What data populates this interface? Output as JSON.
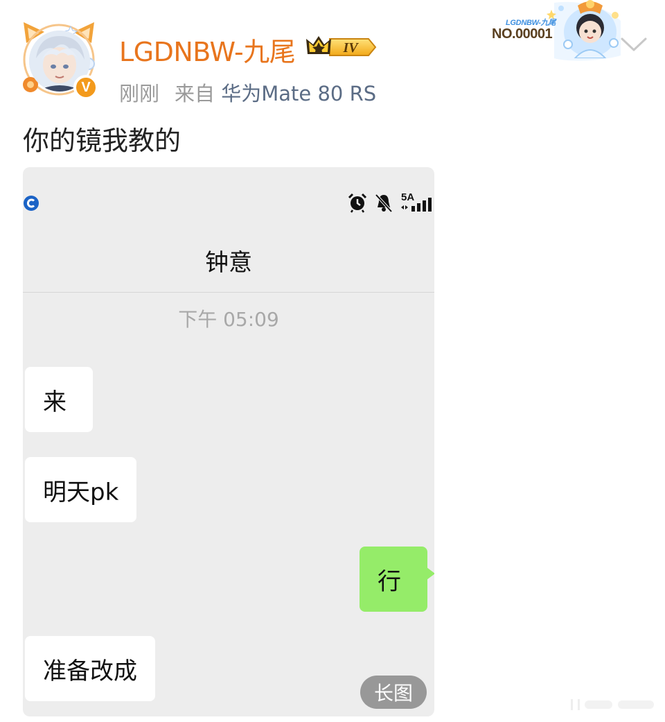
{
  "author": {
    "name": "LGDNBW-九尾",
    "level_badge": "IV",
    "verified_badge": "V"
  },
  "post": {
    "time": "刚刚",
    "source_prefix": "来自",
    "device": "华为Mate 80 RS",
    "text": "你的镜我教的"
  },
  "fan_card": {
    "caption": "LGDNBW-九尾",
    "number": "NO.00001"
  },
  "colors": {
    "username": "#e8751d",
    "meta": "#9a9a9a",
    "device": "#5b6c85",
    "chat_bg": "#ededed",
    "my_bubble": "#95ec69",
    "their_bubble": "#ffffff"
  },
  "screenshot": {
    "status_right": {
      "network": "5A"
    },
    "chat_title": "钟意",
    "timestamp": "下午 05:09",
    "messages": [
      {
        "side": "left",
        "text": "来"
      },
      {
        "side": "left",
        "text": "明天pk"
      },
      {
        "side": "right",
        "text": "行"
      },
      {
        "side": "left",
        "text": "准备改成"
      }
    ],
    "long_image_label": "长图"
  },
  "icons": [
    "chevron-down-icon",
    "alarm-icon",
    "mute-bell-icon",
    "signal-icon",
    "app-status-icon",
    "crown-icon"
  ]
}
